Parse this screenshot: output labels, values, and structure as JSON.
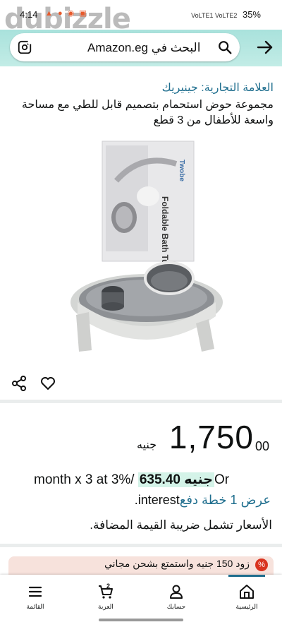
{
  "status_bar": {
    "time": "4:14",
    "watermark": "dubizzle",
    "signal_text": "VoLTE1 VoLTE2",
    "battery": "35%"
  },
  "search": {
    "text": "البحث في Amazon.eg"
  },
  "product": {
    "brand": "العلامة التجارية: جينيريك",
    "title": "مجموعة حوض استحمام بتصميم قابل للطي مع مساحة واسعة للأطفال من 3 قطع",
    "image_box_text": "Foldable Bath Tub Set",
    "image_brand": "Twobe"
  },
  "price": {
    "whole": "1,750",
    "fraction": "00",
    "currency": "جنيه"
  },
  "installment": {
    "prefix": "month x 3 at 3%/",
    "amount": "635.40 جنيه",
    "suffix": "Or",
    "line2_link": "عرض 1 خطة دفع",
    "line2_text": ".interest"
  },
  "vat": "الأسعار تشمل ضريبة القيمة المضافة.",
  "promo": {
    "text": "زود 150 جنيه واستمتع بشحن مجاني",
    "badge": "%"
  },
  "bottom_nav": {
    "home": "الرئيسية",
    "account": "حسابك",
    "cart": "العربة",
    "cart_count": "2",
    "menu": "القائمة"
  }
}
